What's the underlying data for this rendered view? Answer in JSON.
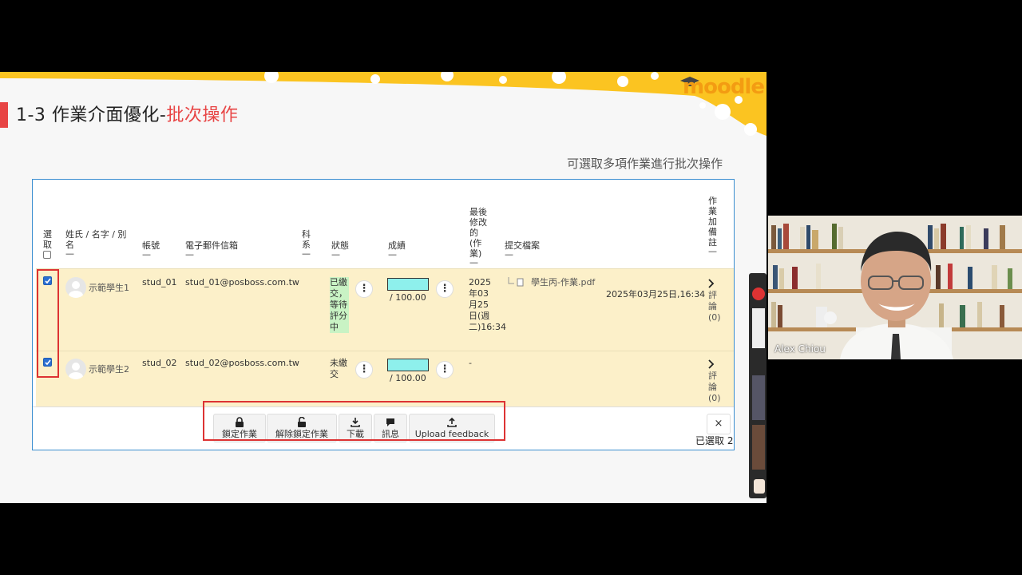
{
  "slide": {
    "title_prefix": "1-3 作業介面優化-",
    "title_highlight": "批次操作",
    "logo": "moodle",
    "subtitle": "可選取多項作業進行批次操作"
  },
  "table": {
    "headers": {
      "select": "選取",
      "name": "姓氏 / 名字 / 別名",
      "username": "帳號",
      "email": "電子郵件信箱",
      "department": "科系",
      "status": "狀態",
      "grade": "成績",
      "last_modified": "最後修改的(作業)",
      "files": "提交檔案",
      "feedback": "作業加備註",
      "sort_mark": "—"
    },
    "rows": [
      {
        "name": "示範學生1",
        "username": "stud_01",
        "email": "stud_01@posboss.com.tw",
        "status": "已繳交，等待評分中",
        "grade_suffix": "/ 100.00",
        "modified": "2025年03月25日(週二)16:34",
        "file": "學生丙-作業.pdf",
        "file_time": "2025年03月25日,16:34",
        "feedback": "評論 (0)"
      },
      {
        "name": "示範學生2",
        "username": "stud_02",
        "email": "stud_02@posboss.com.tw",
        "status": "未繳交",
        "grade_suffix": "/ 100.00",
        "modified": "-",
        "file": "",
        "file_time": "",
        "feedback": "評論 (0)"
      }
    ]
  },
  "bulk_actions": {
    "lock": "鎖定作業",
    "unlock": "解除鎖定作業",
    "download": "下載",
    "message": "訊息",
    "upload_feedback": "Upload feedback",
    "close": "×",
    "selected_count": "已選取 2"
  },
  "webcam": {
    "name": "Alex Chiou"
  }
}
